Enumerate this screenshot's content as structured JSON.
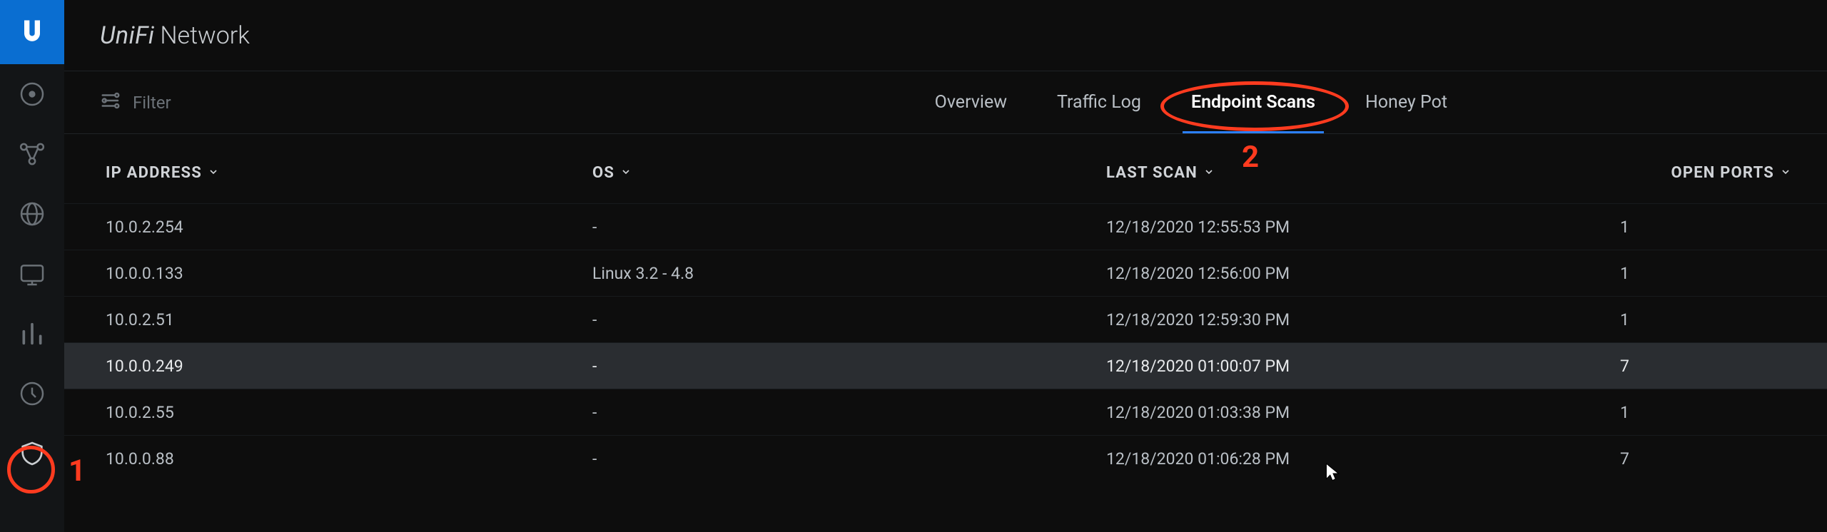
{
  "brand": {
    "name": "UniFi",
    "sub": "Network"
  },
  "subheader": {
    "filter_label": "Filter",
    "tabs": [
      {
        "label": "Overview",
        "active": false
      },
      {
        "label": "Traffic Log",
        "active": false
      },
      {
        "label": "Endpoint Scans",
        "active": true
      },
      {
        "label": "Honey Pot",
        "active": false
      }
    ]
  },
  "table": {
    "columns": {
      "ip": "IP ADDRESS",
      "os": "OS",
      "last": "LAST SCAN",
      "ports": "OPEN PORTS"
    },
    "rows": [
      {
        "ip": "10.0.2.254",
        "os": "-",
        "last": "12/18/2020 12:55:53 PM",
        "ports": "1",
        "hovered": false
      },
      {
        "ip": "10.0.0.133",
        "os": "Linux 3.2 - 4.8",
        "last": "12/18/2020 12:56:00 PM",
        "ports": "1",
        "hovered": false
      },
      {
        "ip": "10.0.2.51",
        "os": "-",
        "last": "12/18/2020 12:59:30 PM",
        "ports": "1",
        "hovered": false
      },
      {
        "ip": "10.0.0.249",
        "os": "-",
        "last": "12/18/2020 01:00:07 PM",
        "ports": "7",
        "hovered": true
      },
      {
        "ip": "10.0.2.55",
        "os": "-",
        "last": "12/18/2020 01:03:38 PM",
        "ports": "1",
        "hovered": false
      },
      {
        "ip": "10.0.0.88",
        "os": "-",
        "last": "12/18/2020 01:06:28 PM",
        "ports": "7",
        "hovered": false
      }
    ]
  },
  "annotations": {
    "label1": "1",
    "label2": "2"
  }
}
